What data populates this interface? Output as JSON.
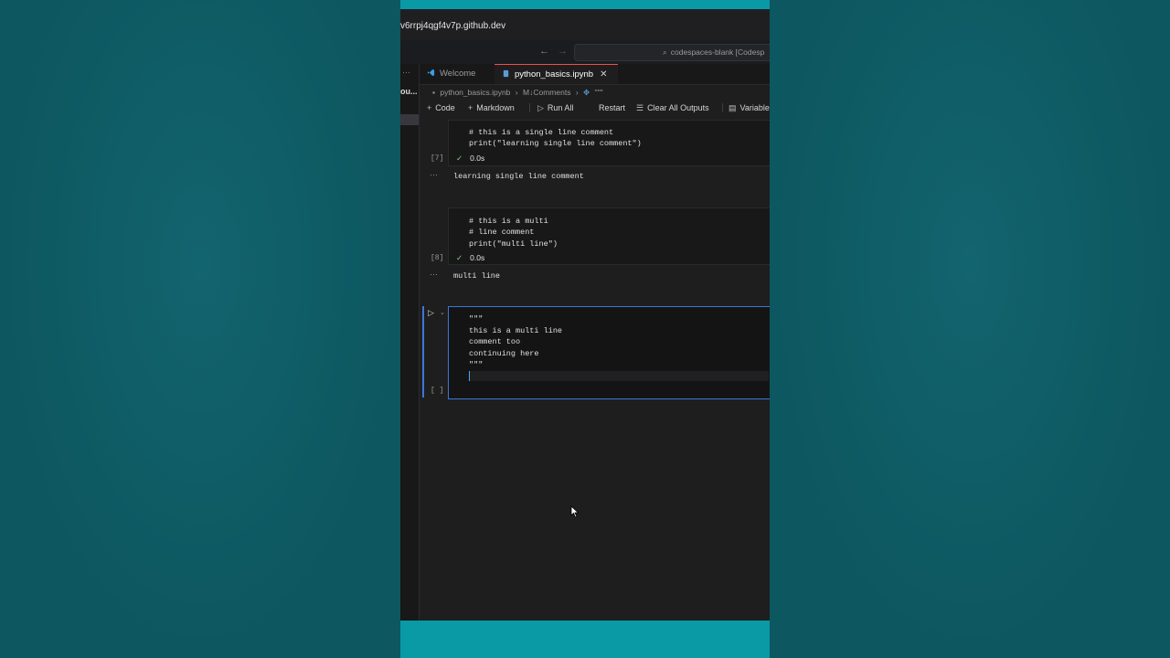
{
  "browser": {
    "url": "v6rrpj4qgf4v7p.github.dev",
    "search_text": "codespaces-blank [Codesp"
  },
  "sidebar": {
    "dots": "···",
    "label": "ou..."
  },
  "tabs": [
    {
      "label": "Welcome",
      "icon": "vscode-icon"
    },
    {
      "label": "python_basics.ipynb",
      "icon": "notebook-icon",
      "close": "✕"
    }
  ],
  "breadcrumb": {
    "file": "python_basics.ipynb",
    "section": "M↓Comments",
    "cell": "\"\"\""
  },
  "toolbar": {
    "code": "Code",
    "markdown": "Markdown",
    "run_all": "Run All",
    "restart": "Restart",
    "clear_outputs": "Clear All Outputs",
    "variables": "Variable"
  },
  "cells": [
    {
      "exec_count": "[7]",
      "lines": [
        "# this is a single line comment",
        "print(\"learning single line comment\")"
      ],
      "time": "0.0s",
      "output_dots": "···",
      "output": "learning single line comment"
    },
    {
      "exec_count": "[8]",
      "lines": [
        "# this is a multi",
        "# line comment",
        "print(\"multi line\")"
      ],
      "time": "0.0s",
      "output_dots": "···",
      "output": "multi line"
    },
    {
      "exec_count": "[ ]",
      "lines": [
        "\"\"\"",
        "this is a multi line",
        "comment too",
        "continuing here",
        "\"\"\""
      ]
    }
  ],
  "colors": {
    "accent": "#3a78d8",
    "success": "#89d185",
    "tab_border": "#f14c4c",
    "background": "#0f5c66",
    "strip": "#0a9aa6"
  }
}
